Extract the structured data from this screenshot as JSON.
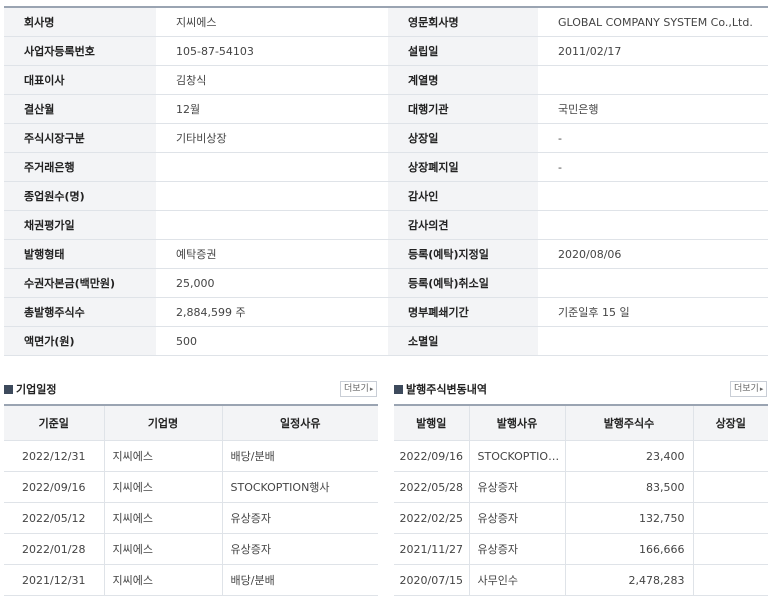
{
  "company_info": [
    [
      "회사명",
      "지씨에스",
      "영문회사명",
      "GLOBAL COMPANY SYSTEM Co.,Ltd."
    ],
    [
      "사업자등록번호",
      "105-87-54103",
      "설립일",
      "2011/02/17"
    ],
    [
      "대표이사",
      "김창식",
      "계열명",
      ""
    ],
    [
      "결산월",
      "12월",
      "대행기관",
      "국민은행"
    ],
    [
      "주식시장구분",
      "기타비상장",
      "상장일",
      "-"
    ],
    [
      "주거래은행",
      "",
      "상장폐지일",
      "-"
    ],
    [
      "종업원수(명)",
      "",
      "감사인",
      ""
    ],
    [
      "채권평가일",
      "",
      "감사의견",
      ""
    ],
    [
      "발행형태",
      "예탁증권",
      "등록(예탁)지정일",
      "2020/08/06"
    ],
    [
      "수권자본금(백만원)",
      "25,000",
      "등록(예탁)취소일",
      ""
    ],
    [
      "총발행주식수",
      "2,884,599 주",
      "명부폐쇄기간",
      "기준일후 15 일"
    ],
    [
      "액면가(원)",
      "500",
      "소멸일",
      ""
    ]
  ],
  "schedule": {
    "title": "기업일정",
    "more_label": "더보기",
    "headers": [
      "기준일",
      "기업명",
      "일정사유"
    ],
    "rows": [
      [
        "2022/12/31",
        "지씨에스",
        "배당/분배"
      ],
      [
        "2022/09/16",
        "지씨에스",
        "STOCKOPTION행사"
      ],
      [
        "2022/05/12",
        "지씨에스",
        "유상증자"
      ],
      [
        "2022/01/28",
        "지씨에스",
        "유상증자"
      ],
      [
        "2021/12/31",
        "지씨에스",
        "배당/분배"
      ]
    ]
  },
  "share_changes": {
    "title": "발행주식변동내역",
    "more_label": "더보기",
    "headers": [
      "발행일",
      "발행사유",
      "발행주식수",
      "상장일"
    ],
    "rows": [
      [
        "2022/09/16",
        "STOCKOPTIO…",
        "23,400",
        ""
      ],
      [
        "2022/05/28",
        "유상증자",
        "83,500",
        ""
      ],
      [
        "2022/02/25",
        "유상증자",
        "132,750",
        ""
      ],
      [
        "2021/11/27",
        "유상증자",
        "166,666",
        ""
      ],
      [
        "2020/07/15",
        "사무인수",
        "2,478,283",
        ""
      ]
    ]
  }
}
